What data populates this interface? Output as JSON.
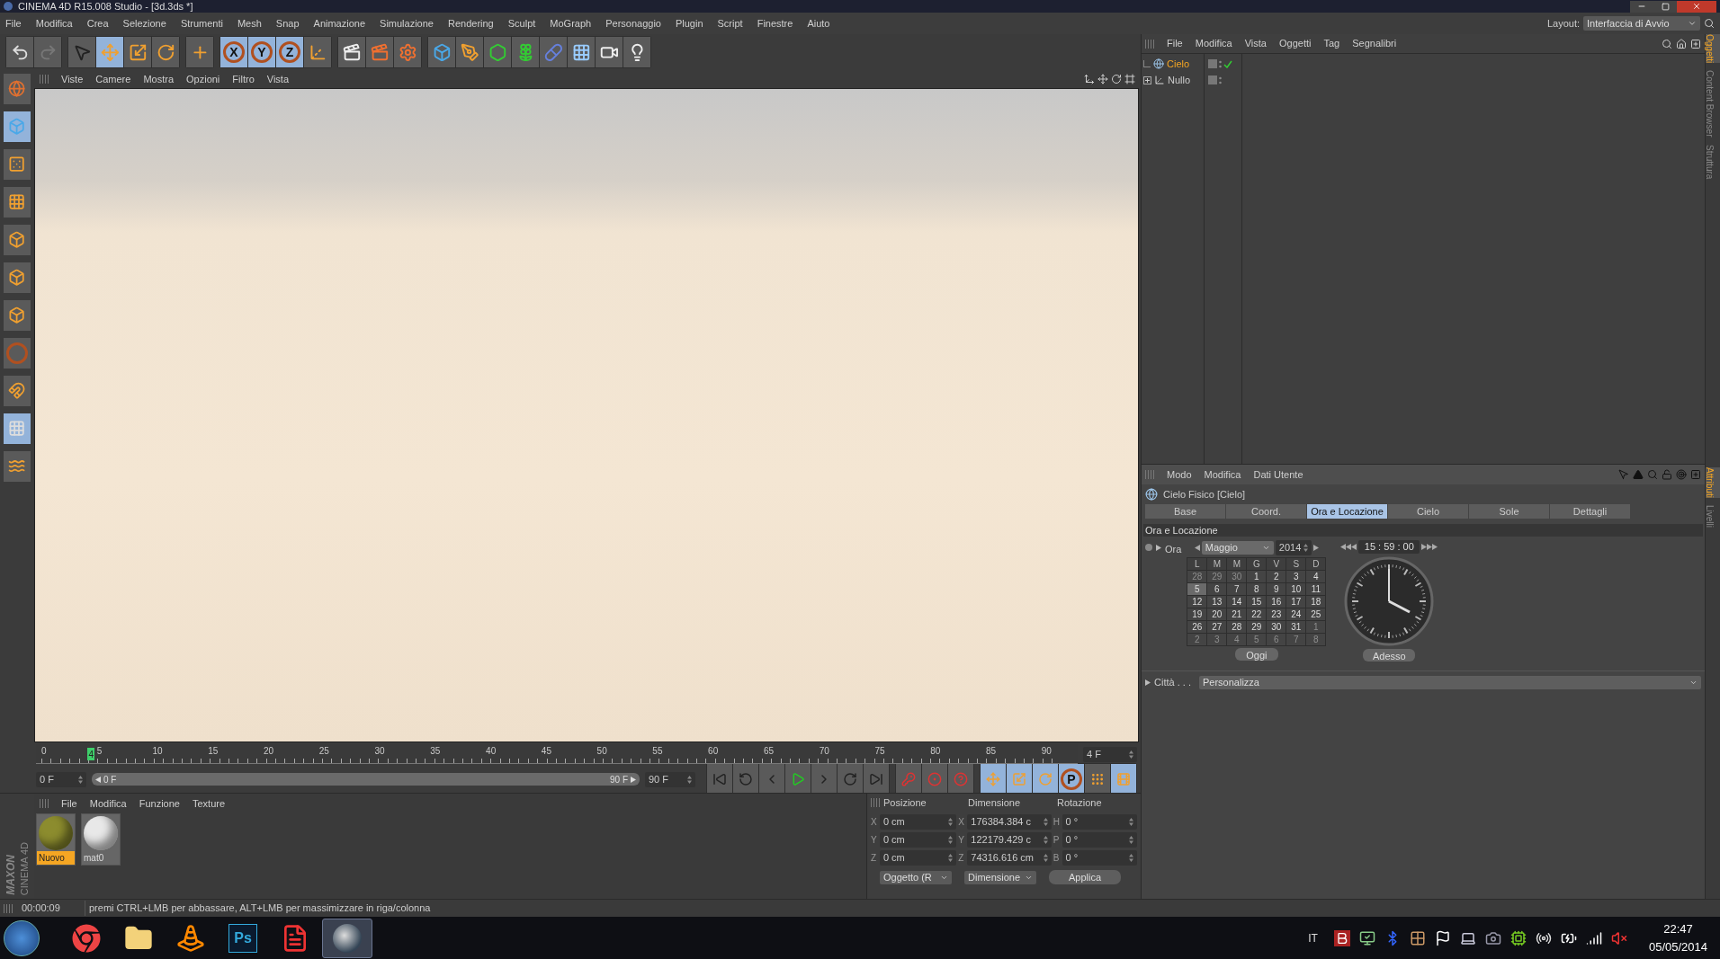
{
  "window": {
    "title": "CINEMA 4D R15.008 Studio - [3d.3ds *]"
  },
  "menu": [
    "File",
    "Modifica",
    "Crea",
    "Selezione",
    "Strumenti",
    "Mesh",
    "Snap",
    "Animazione",
    "Simulazione",
    "Rendering",
    "Sculpt",
    "MoGraph",
    "Personaggio",
    "Plugin",
    "Script",
    "Finestre",
    "Aiuto"
  ],
  "layout": {
    "label": "Layout:",
    "value": "Interfaccia di Avvio"
  },
  "toolbar": [
    [
      {
        "kind": "undo",
        "active": false
      },
      {
        "kind": "redo",
        "active": false
      }
    ],
    [
      {
        "kind": "select",
        "active": false
      },
      {
        "kind": "move",
        "active": true
      },
      {
        "kind": "scale",
        "active": false
      },
      {
        "kind": "rotate",
        "active": false
      }
    ],
    [
      {
        "kind": "add",
        "active": false
      }
    ],
    [
      {
        "kind": "axis",
        "label": "X",
        "active": true
      },
      {
        "kind": "axis",
        "label": "Y",
        "active": true
      },
      {
        "kind": "axis",
        "label": "Z",
        "active": true
      },
      {
        "kind": "coords",
        "active": false
      }
    ],
    [
      {
        "kind": "render_view",
        "active": false
      },
      {
        "kind": "render_picture",
        "active": false
      },
      {
        "kind": "render_settings",
        "active": false
      }
    ],
    [
      {
        "kind": "cube",
        "active": false
      },
      {
        "kind": "pen",
        "active": false
      },
      {
        "kind": "subdivide",
        "active": false
      },
      {
        "kind": "cloner",
        "active": false
      },
      {
        "kind": "deformer",
        "active": false
      },
      {
        "kind": "floor",
        "active": false
      },
      {
        "kind": "camera",
        "active": false
      },
      {
        "kind": "light",
        "active": false
      }
    ]
  ],
  "left_tools": [
    {
      "kind": "globe",
      "active": false
    },
    {
      "kind": "cube",
      "active": true
    },
    {
      "kind": "checker",
      "active": false
    },
    {
      "kind": "grid",
      "active": false
    },
    {
      "kind": "points",
      "active": false
    },
    {
      "kind": "edges",
      "active": false
    },
    {
      "kind": "polygons",
      "active": false
    },
    {
      "kind": "axis",
      "active": false
    },
    {
      "kind": "magnet",
      "active": false
    },
    {
      "kind": "grid_lock",
      "active": true
    },
    {
      "kind": "grid_wave",
      "active": false
    }
  ],
  "viewport": {
    "menu": [
      "Viste",
      "Camere",
      "Mostra",
      "Opzioni",
      "Filtro",
      "Vista"
    ]
  },
  "timeline": {
    "labels": [
      "0",
      "5",
      "10",
      "15",
      "20",
      "25",
      "30",
      "35",
      "40",
      "45",
      "50",
      "55",
      "60",
      "65",
      "70",
      "75",
      "80",
      "85",
      "90"
    ],
    "current": "4",
    "level": 0.044,
    "frame_field": "4 F"
  },
  "playback": {
    "level": 1,
    "start": "0 F",
    "range_start": "0 F",
    "range_end": "90 F",
    "end": "90 F",
    "controls": [
      {
        "kind": "first",
        "active": false
      },
      {
        "kind": "prev_key",
        "active": false
      },
      {
        "kind": "prev_frame",
        "active": false
      },
      {
        "kind": "play",
        "active": false
      },
      {
        "kind": "next_frame",
        "active": false
      },
      {
        "kind": "next_key",
        "active": false
      },
      {
        "kind": "last",
        "active": false
      }
    ],
    "record": [
      {
        "kind": "record",
        "active": false
      },
      {
        "kind": "autokey",
        "active": false
      },
      {
        "kind": "help",
        "active": false
      }
    ],
    "keys": [
      {
        "kind": "move",
        "active": true
      },
      {
        "kind": "scale",
        "active": true
      },
      {
        "kind": "rotate",
        "active": true
      },
      {
        "kind": "param",
        "label": "P",
        "active": true
      },
      {
        "kind": "dots",
        "active": false
      },
      {
        "kind": "film",
        "active": true
      }
    ]
  },
  "materials": {
    "menu": [
      "File",
      "Modifica",
      "Funzione",
      "Texture"
    ],
    "items": [
      {
        "name": "Nuovo",
        "selected": true,
        "color": "#8c8c2e"
      },
      {
        "name": "mat0",
        "selected": false,
        "color": "#e8e8e8"
      }
    ]
  },
  "logo": {
    "line1": "MAXON",
    "line2": "CINEMA 4D"
  },
  "coordinates": {
    "headers": [
      "Posizione",
      "Dimensione",
      "Rotazione"
    ],
    "rows": [
      {
        "axis": "X",
        "position": "0 cm",
        "size_axis": "X",
        "size": "176384.384 c",
        "rot_axis": "H",
        "rotation": "0 °"
      },
      {
        "axis": "Y",
        "position": "0 cm",
        "size_axis": "Y",
        "size": "122179.429 c",
        "rot_axis": "P",
        "rotation": "0 °"
      },
      {
        "axis": "Z",
        "position": "0 cm",
        "size_axis": "Z",
        "size": "74316.616 cm",
        "rot_axis": "B",
        "rotation": "0 °"
      }
    ],
    "mode": "Oggetto (R",
    "size_mode": "Dimensione",
    "apply": "Applica"
  },
  "objects": {
    "menu": [
      "File",
      "Modifica",
      "Vista",
      "Oggetti",
      "Tag",
      "Segnalibri"
    ],
    "items": [
      {
        "name": "Cielo",
        "kind": "sky",
        "selected": true,
        "enabled": true,
        "has_children": false
      },
      {
        "name": "Nullo",
        "kind": "null",
        "selected": false,
        "enabled": false,
        "has_children": true
      }
    ]
  },
  "side_tabs_top": [
    {
      "label": "Oggetti",
      "selected": true
    },
    {
      "label": "Content Browser",
      "selected": false
    },
    {
      "label": "Struttura",
      "selected": false
    }
  ],
  "side_tabs_bottom": [
    {
      "label": "Attributi",
      "selected": true
    },
    {
      "label": "Livelli",
      "selected": false
    }
  ],
  "attributes": {
    "menu": [
      "Modo",
      "Modifica",
      "Dati Utente"
    ],
    "title": "Cielo Fisico [Cielo]",
    "tabs": [
      {
        "label": "Base",
        "selected": false
      },
      {
        "label": "Coord.",
        "selected": false
      },
      {
        "label": "Ora e Locazione",
        "selected": true
      },
      {
        "label": "Cielo",
        "selected": false
      },
      {
        "label": "Sole",
        "selected": false
      },
      {
        "label": "Dettagli",
        "selected": false
      }
    ],
    "section": "Ora e Locazione",
    "time_label": "Ora",
    "month": "Maggio",
    "year": "2014",
    "time": "15 : 59 : 00",
    "weekdays": [
      "L",
      "M",
      "M",
      "G",
      "V",
      "S",
      "D"
    ],
    "weeks": [
      [
        {
          "day": "28",
          "in_month": false,
          "selected": false
        },
        {
          "day": "29",
          "in_month": false,
          "selected": false
        },
        {
          "day": "30",
          "in_month": false,
          "selected": false
        },
        {
          "day": "1",
          "in_month": true,
          "selected": false
        },
        {
          "day": "2",
          "in_month": true,
          "selected": false
        },
        {
          "day": "3",
          "in_month": true,
          "selected": false
        },
        {
          "day": "4",
          "in_month": true,
          "selected": false
        }
      ],
      [
        {
          "day": "5",
          "in_month": true,
          "selected": true
        },
        {
          "day": "6",
          "in_month": true,
          "selected": false
        },
        {
          "day": "7",
          "in_month": true,
          "selected": false
        },
        {
          "day": "8",
          "in_month": true,
          "selected": false
        },
        {
          "day": "9",
          "in_month": true,
          "selected": false
        },
        {
          "day": "10",
          "in_month": true,
          "selected": false
        },
        {
          "day": "11",
          "in_month": true,
          "selected": false
        }
      ],
      [
        {
          "day": "12",
          "in_month": true,
          "selected": false
        },
        {
          "day": "13",
          "in_month": true,
          "selected": false
        },
        {
          "day": "14",
          "in_month": true,
          "selected": false
        },
        {
          "day": "15",
          "in_month": true,
          "selected": false
        },
        {
          "day": "16",
          "in_month": true,
          "selected": false
        },
        {
          "day": "17",
          "in_month": true,
          "selected": false
        },
        {
          "day": "18",
          "in_month": true,
          "selected": false
        }
      ],
      [
        {
          "day": "19",
          "in_month": true,
          "selected": false
        },
        {
          "day": "20",
          "in_month": true,
          "selected": false
        },
        {
          "day": "21",
          "in_month": true,
          "selected": false
        },
        {
          "day": "22",
          "in_month": true,
          "selected": false
        },
        {
          "day": "23",
          "in_month": true,
          "selected": false
        },
        {
          "day": "24",
          "in_month": true,
          "selected": false
        },
        {
          "day": "25",
          "in_month": true,
          "selected": false
        }
      ],
      [
        {
          "day": "26",
          "in_month": true,
          "selected": false
        },
        {
          "day": "27",
          "in_month": true,
          "selected": false
        },
        {
          "day": "28",
          "in_month": true,
          "selected": false
        },
        {
          "day": "29",
          "in_month": true,
          "selected": false
        },
        {
          "day": "30",
          "in_month": true,
          "selected": false
        },
        {
          "day": "31",
          "in_month": true,
          "selected": false
        },
        {
          "day": "1",
          "in_month": false,
          "selected": false
        }
      ],
      [
        {
          "day": "2",
          "in_month": false,
          "selected": false
        },
        {
          "day": "3",
          "in_month": false,
          "selected": false
        },
        {
          "day": "4",
          "in_month": false,
          "selected": false
        },
        {
          "day": "5",
          "in_month": false,
          "selected": false
        },
        {
          "day": "6",
          "in_month": false,
          "selected": false
        },
        {
          "day": "7",
          "in_month": false,
          "selected": false
        },
        {
          "day": "8",
          "in_month": false,
          "selected": false
        }
      ]
    ],
    "today_button": "Oggi",
    "now_button": "Adesso",
    "city_label": "Città . . .",
    "city": "Personalizza"
  },
  "status": {
    "time": "00:00:09",
    "message": "premi CTRL+LMB per abbassare, ALT+LMB per massimizzare in riga/colonna"
  },
  "taskbar": {
    "apps": [
      {
        "kind": "browser",
        "active": false
      },
      {
        "kind": "folder",
        "active": false
      },
      {
        "kind": "cone",
        "active": false
      },
      {
        "kind": "ps",
        "label": "Ps",
        "active": false
      },
      {
        "kind": "pdf",
        "active": false
      },
      {
        "kind": "c4d",
        "active": true
      }
    ],
    "language": "IT",
    "time": "22:47",
    "date": "05/05/2014"
  }
}
